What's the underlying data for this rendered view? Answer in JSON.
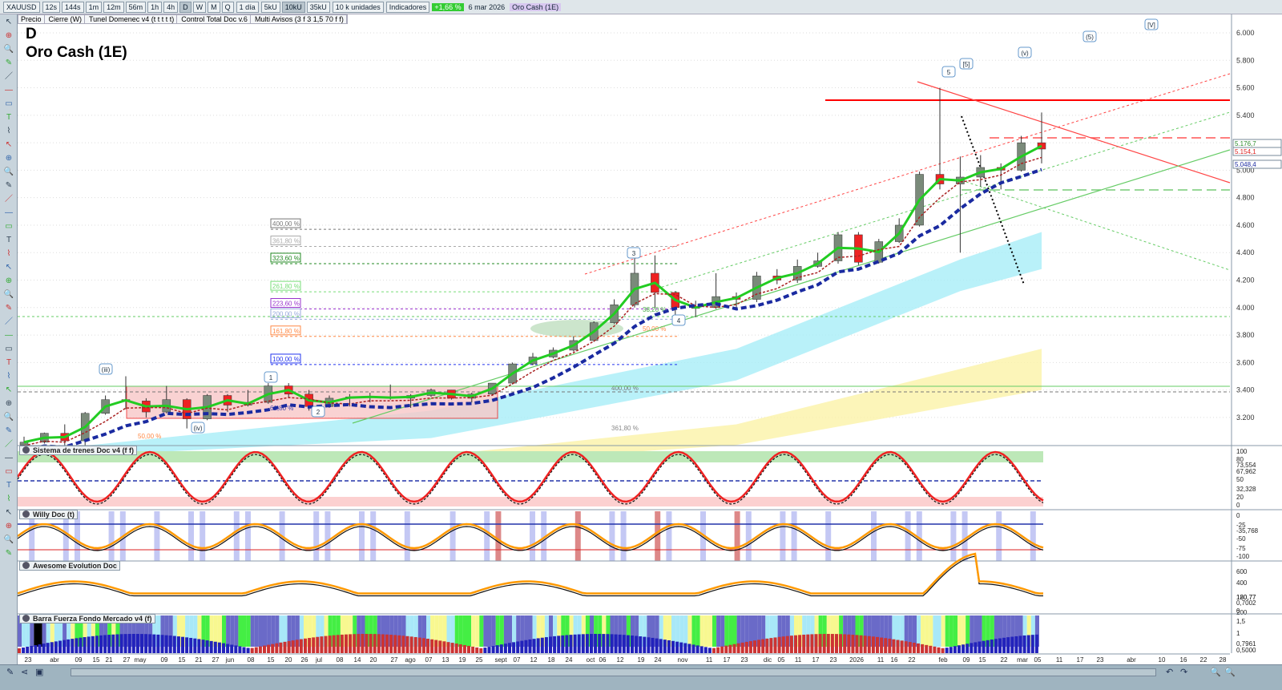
{
  "toolbar": {
    "symbol": "XAUUSD",
    "periods": [
      "12s",
      "144s",
      "1m",
      "12m",
      "56m",
      "1h",
      "4h",
      "D",
      "W",
      "M",
      "Q"
    ],
    "active_period": "D",
    "interval": "1 día",
    "units": [
      "5kU",
      "10kU",
      "35kU"
    ],
    "active_unit": "10kU",
    "units_select": "10 k unidades",
    "indicators": "Indicadores",
    "change": "+1,66 %",
    "date": "6 mar 2026",
    "instrument": "Oro Cash (1E)"
  },
  "legend": [
    "Precio",
    "Cierre (W)",
    "Tunel Domenec v4 (t t t t t)",
    "Control Total Doc v.6",
    "Multi Avisos (3 f 3 1,5 70 f f)"
  ],
  "header": {
    "timeframe": "D",
    "name": "Oro Cash (1E)"
  },
  "colors": {
    "up": "#22aa22",
    "down": "#dd2222",
    "ma_fast": "#22cc22",
    "ma_slow": "#1a2aa0",
    "resistance": "#ff0000"
  },
  "price_axis": {
    "ticks": [
      "6.000",
      "5.800",
      "5.600",
      "5.400",
      "5.200",
      "5.000",
      "4.800",
      "4.600",
      "4.400",
      "4.200",
      "4.000",
      "3.800",
      "3.600",
      "3.400",
      "3.200"
    ],
    "labels": [
      {
        "text": "5.176,7",
        "color": "#2a8a2a"
      },
      {
        "text": "5.154,1",
        "color": "#dd2222"
      },
      {
        "text": "5.048,4",
        "color": "#1a2aa0"
      }
    ]
  },
  "fib_levels": [
    {
      "text": "400,00 %",
      "color": "#777777",
      "price": 4570
    },
    {
      "text": "361,80 %",
      "color": "#aaaaaa",
      "price": 4445
    },
    {
      "text": "323,60 %",
      "color": "#228822",
      "price": 4320
    },
    {
      "text": "261,80 %",
      "color": "#77dd77",
      "price": 4115
    },
    {
      "text": "223,60 %",
      "color": "#9933cc",
      "price": 3990
    },
    {
      "text": "200,00 %",
      "color": "#99aadd",
      "price": 3915
    },
    {
      "text": "161,80 %",
      "color": "#ff8844",
      "price": 3790
    },
    {
      "text": "100,00 %",
      "color": "#2233ee",
      "price": 3585
    }
  ],
  "extra_fib": [
    "400,00 %",
    "361,80 %",
    "61,80 %",
    "50,00 %",
    "38,20 %",
    "50,00 %"
  ],
  "waves": [
    "(iii)",
    "1",
    "(iv)",
    "2",
    "3",
    "4",
    "5",
    "[5]",
    "(v)",
    "(5)",
    "[V]"
  ],
  "panes": [
    {
      "title": "Sistema de trenes Doc v4 (f f)",
      "ticks": [
        "100",
        "80",
        "73,554",
        "67,962",
        "50",
        "32,328",
        "20",
        "0"
      ]
    },
    {
      "title": "Willy Doc (t)",
      "ticks": [
        "0",
        "-25",
        "-35,768",
        "-50",
        "-75",
        "-100"
      ]
    },
    {
      "title": "Awesome Evolution Doc",
      "ticks": [
        "600",
        "400",
        "180,77",
        "120,77",
        "0,7002",
        "0",
        "200"
      ]
    },
    {
      "title": "Barra Fuerza Fondo Mercado v4 (f)",
      "ticks": [
        "1,5",
        "1",
        "0,7961",
        "0,5000"
      ]
    }
  ],
  "x_axis": [
    "23",
    "abr",
    "09",
    "15",
    "21",
    "27",
    "may",
    "09",
    "15",
    "21",
    "27",
    "jun",
    "08",
    "15",
    "20",
    "26",
    "jul",
    "08",
    "14",
    "20",
    "27",
    "ago",
    "07",
    "13",
    "19",
    "25",
    "sept",
    "07",
    "12",
    "18",
    "24",
    "oct",
    "06",
    "12",
    "19",
    "24",
    "nov",
    "11",
    "17",
    "23",
    "dic",
    "05",
    "11",
    "17",
    "23",
    "2026",
    "11",
    "16",
    "22",
    "feb",
    "09",
    "15",
    "22",
    "mar",
    "05",
    "11",
    "17",
    "23",
    "abr",
    "10",
    "16",
    "22",
    "28"
  ],
  "chart_data": {
    "type": "candlestick",
    "title": "Oro Cash (1E)",
    "xlabel": "",
    "ylabel": "",
    "ylim": [
      3050,
      6100
    ],
    "grid": true,
    "interval": "weekly approximation",
    "x": [
      "2025-03-17",
      "2025-03-24",
      "2025-03-31",
      "2025-04-07",
      "2025-04-14",
      "2025-04-21",
      "2025-04-28",
      "2025-05-05",
      "2025-05-12",
      "2025-05-19",
      "2025-05-26",
      "2025-06-02",
      "2025-06-09",
      "2025-06-16",
      "2025-06-23",
      "2025-06-30",
      "2025-07-07",
      "2025-07-14",
      "2025-07-21",
      "2025-07-28",
      "2025-08-04",
      "2025-08-11",
      "2025-08-18",
      "2025-08-25",
      "2025-09-01",
      "2025-09-08",
      "2025-09-15",
      "2025-09-22",
      "2025-09-29",
      "2025-10-06",
      "2025-10-13",
      "2025-10-20",
      "2025-10-27",
      "2025-11-03",
      "2025-11-10",
      "2025-11-17",
      "2025-11-24",
      "2025-12-01",
      "2025-12-08",
      "2025-12-15",
      "2025-12-22",
      "2025-12-29",
      "2026-01-05",
      "2026-01-12",
      "2026-01-19",
      "2026-01-26",
      "2026-02-02",
      "2026-02-09",
      "2026-02-16",
      "2026-02-23",
      "2026-03-02"
    ],
    "ohlc": [
      [
        3000,
        3060,
        2980,
        3020
      ],
      [
        3020,
        3090,
        3010,
        3085
      ],
      [
        3085,
        3150,
        2970,
        3030
      ],
      [
        3030,
        3240,
        2960,
        3230
      ],
      [
        3230,
        3360,
        3220,
        3330
      ],
      [
        3330,
        3500,
        3260,
        3320
      ],
      [
        3320,
        3340,
        3200,
        3240
      ],
      [
        3240,
        3430,
        3230,
        3330
      ],
      [
        3330,
        3340,
        3120,
        3190
      ],
      [
        3190,
        3370,
        3180,
        3360
      ],
      [
        3360,
        3370,
        3240,
        3290
      ],
      [
        3290,
        3400,
        3280,
        3310
      ],
      [
        3310,
        3450,
        3300,
        3430
      ],
      [
        3430,
        3450,
        3340,
        3370
      ],
      [
        3370,
        3400,
        3250,
        3280
      ],
      [
        3280,
        3360,
        3270,
        3340
      ],
      [
        3340,
        3370,
        3280,
        3350
      ],
      [
        3350,
        3380,
        3310,
        3350
      ],
      [
        3350,
        3440,
        3330,
        3340
      ],
      [
        3340,
        3370,
        3270,
        3360
      ],
      [
        3360,
        3410,
        3350,
        3400
      ],
      [
        3400,
        3400,
        3330,
        3340
      ],
      [
        3340,
        3380,
        3310,
        3370
      ],
      [
        3370,
        3450,
        3360,
        3450
      ],
      [
        3450,
        3600,
        3440,
        3590
      ],
      [
        3590,
        3670,
        3580,
        3640
      ],
      [
        3640,
        3710,
        3630,
        3690
      ],
      [
        3690,
        3790,
        3680,
        3760
      ],
      [
        3760,
        3900,
        3750,
        3890
      ],
      [
        3890,
        4060,
        3880,
        4020
      ],
      [
        4020,
        4380,
        4000,
        4250
      ],
      [
        4250,
        4380,
        4000,
        4110
      ],
      [
        4110,
        4120,
        3890,
        4000
      ],
      [
        4000,
        4050,
        3930,
        4000
      ],
      [
        4000,
        4250,
        3990,
        4080
      ],
      [
        4080,
        4110,
        4000,
        4060
      ],
      [
        4060,
        4260,
        4040,
        4230
      ],
      [
        4230,
        4280,
        4170,
        4200
      ],
      [
        4200,
        4350,
        4180,
        4300
      ],
      [
        4300,
        4400,
        4290,
        4340
      ],
      [
        4340,
        4550,
        4320,
        4530
      ],
      [
        4530,
        4550,
        4310,
        4330
      ],
      [
        4330,
        4500,
        4320,
        4480
      ],
      [
        4480,
        4650,
        4470,
        4600
      ],
      [
        4600,
        4990,
        4590,
        4970
      ],
      [
        4970,
        5600,
        4860,
        4900
      ],
      [
        4900,
        5100,
        4400,
        4950
      ],
      [
        4950,
        5110,
        4880,
        5020
      ],
      [
        5020,
        5050,
        4860,
        5000
      ],
      [
        5000,
        5250,
        4990,
        5200
      ],
      [
        5200,
        5420,
        5050,
        5154
      ]
    ],
    "resistance": 5510
  }
}
